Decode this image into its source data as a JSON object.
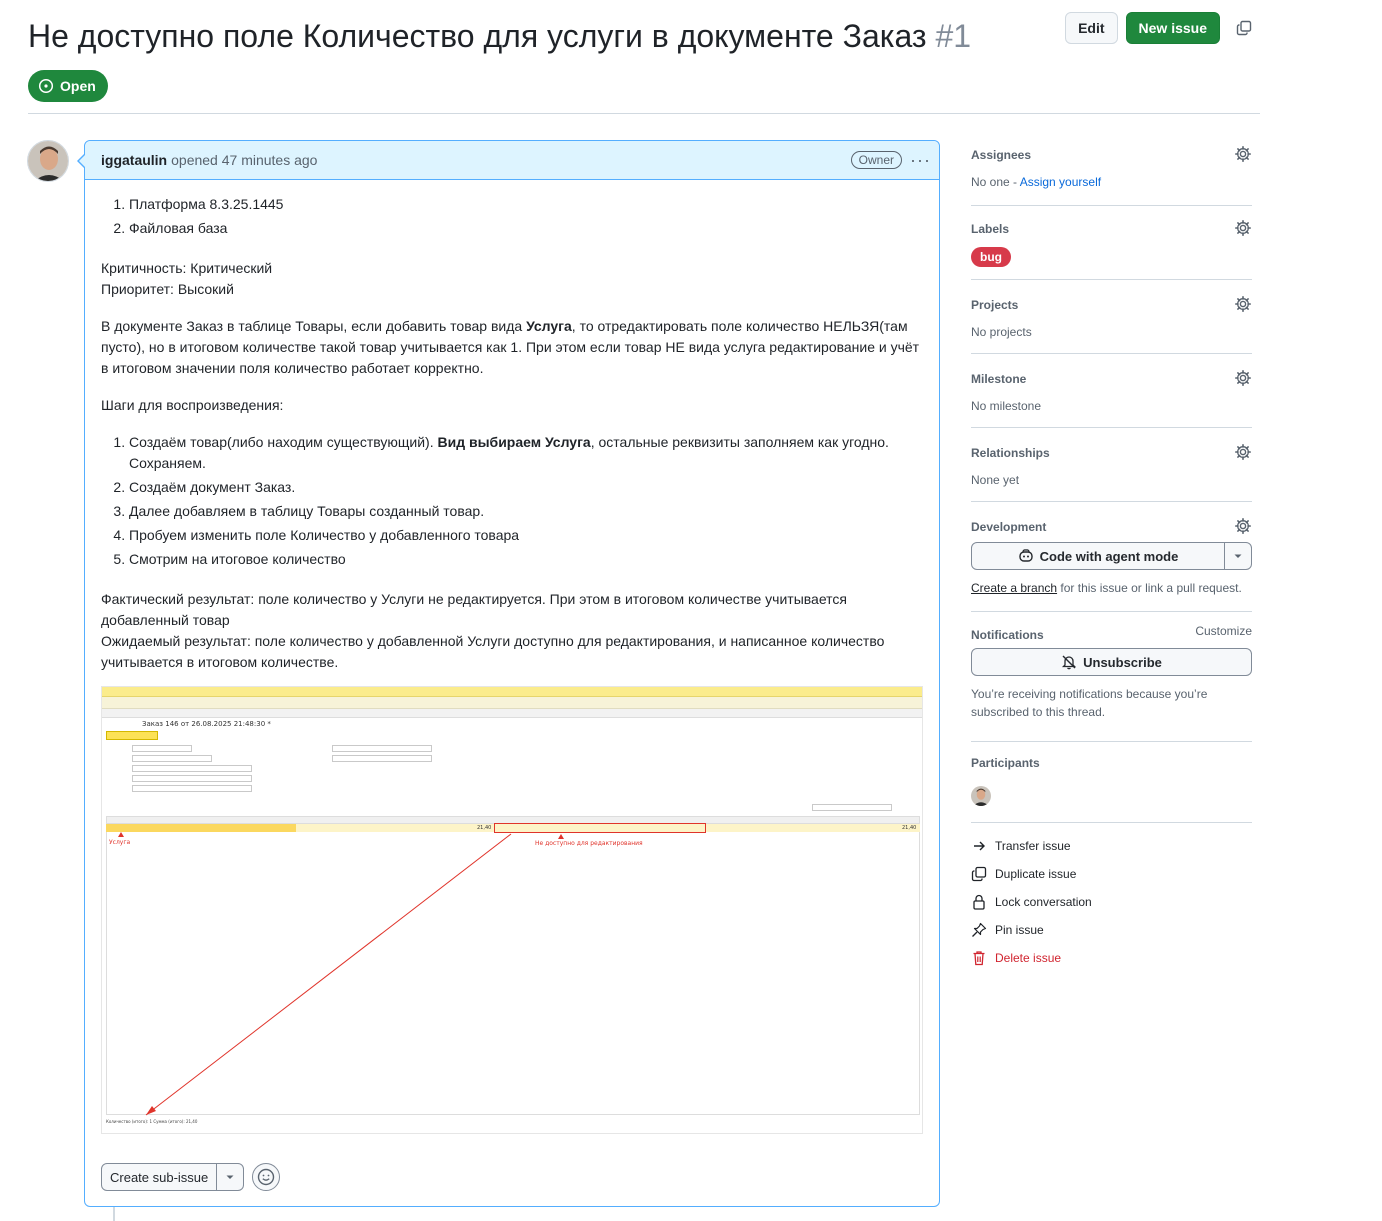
{
  "issue": {
    "title": "Не доступно поле Количество для услуги в документе Заказ",
    "number": "#1",
    "state": "Open"
  },
  "header_actions": {
    "edit_label": "Edit",
    "new_issue_label": "New issue"
  },
  "comment": {
    "author": "iggataulin",
    "meta": "opened 47 minutes ago",
    "owner_badge": "Owner",
    "env_list": [
      "Платформа 8.3.25.1445",
      "Файловая база"
    ],
    "criticality": "Критичность: Критический",
    "priority": "Приоритет: Высокий",
    "description_pre": "В документе Заказ в таблице Товары, если добавить товар вида ",
    "description_bold": "Услуга",
    "description_post": ", то отредактировать поле количество НЕЛЬЗЯ(там пусто), но в итоговом количестве такой товар учитывается как 1. При этом если товар НЕ вида услуга редактирование и учёт в итоговом значении поля количество работает корректно.",
    "steps_title": "Шаги для воспроизведения:",
    "step1_pre": "Создаём товар(либо находим существующий). ",
    "step1_bold": "Вид выбираем Услуга",
    "step1_post": ", остальные реквизиты заполняем как угодно. Сохраняем.",
    "steps_rest": [
      "Создаём документ Заказ.",
      "Далее добавляем в таблицу Товары созданный товар.",
      "Пробуем изменить поле Количество у добавленного товара",
      "Смотрим на итоговое количество"
    ],
    "actual_result": "Фактический результат: поле количество у Услуги не редактируется. При этом в итоговом количестве учитывается добавленный товар",
    "expected_result": "Ожидаемый результат: поле количество у добавленной Услуги доступно для редактирования, и написанное количество учитывается в итоговом количестве.",
    "screenshot": {
      "doc_title": "Заказ 146 от 26.08.2025 21:48:30 *",
      "label_service": "Услуга",
      "label_not_available": "Не доступно для редактирования",
      "price": "21,40",
      "sum": "21,40",
      "footer": "Количество (итого): 1 Сумма (итого): 21,40"
    },
    "create_sub_issue_label": "Create sub-issue"
  },
  "sidebar": {
    "assignees": {
      "heading": "Assignees",
      "value_prefix": "No one - ",
      "link": "Assign yourself"
    },
    "labels": {
      "heading": "Labels",
      "items": [
        "bug"
      ]
    },
    "projects": {
      "heading": "Projects",
      "value": "No projects"
    },
    "milestone": {
      "heading": "Milestone",
      "value": "No milestone"
    },
    "relationships": {
      "heading": "Relationships",
      "value": "None yet"
    },
    "development": {
      "heading": "Development",
      "agent_button": "Code with agent mode",
      "create_branch_link": "Create a branch",
      "create_branch_suffix": " for this issue or link a pull request."
    },
    "notifications": {
      "heading": "Notifications",
      "customize": "Customize",
      "unsubscribe": "Unsubscribe",
      "note": "You’re receiving notifications because you’re subscribed to this thread."
    },
    "participants": {
      "heading": "Participants"
    },
    "actions": {
      "transfer": "Transfer issue",
      "duplicate": "Duplicate issue",
      "lock": "Lock conversation",
      "pin": "Pin issue",
      "delete": "Delete issue"
    }
  },
  "colors": {
    "green": "#1f883d",
    "link_blue": "#0969da",
    "bug_red": "#d73a4a",
    "danger_red": "#d1242f",
    "header_blue": "#ddf4ff"
  }
}
